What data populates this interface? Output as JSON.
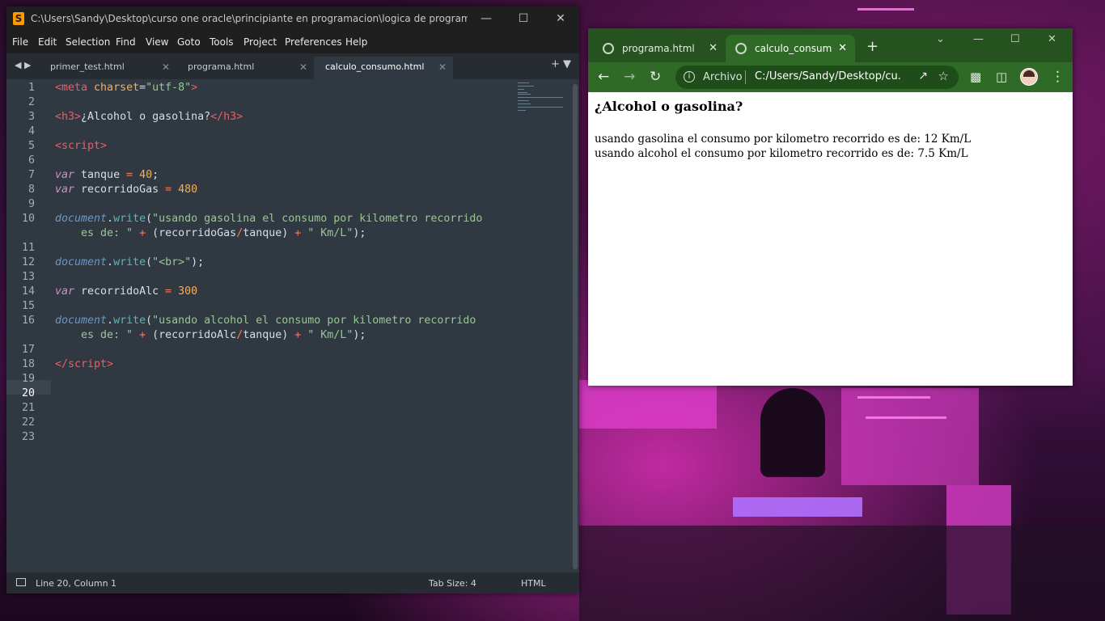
{
  "sublime": {
    "title": "C:\\Users\\Sandy\\Desktop\\curso one oracle\\principiante en programacion\\logica de programacion\\c...",
    "menu": [
      "File",
      "Edit",
      "Selection",
      "Find",
      "View",
      "Goto",
      "Tools",
      "Project",
      "Preferences",
      "Help"
    ],
    "tabs": [
      "primer_test.html",
      "programa.html",
      "calculo_consumo.html"
    ],
    "active_tab": "calculo_consumo.html",
    "line_numbers": [
      "1",
      "2",
      "3",
      "4",
      "5",
      "6",
      "7",
      "8",
      "9",
      "10",
      "",
      "11",
      "12",
      "13",
      "14",
      "15",
      "16",
      "",
      "17",
      "18",
      "19",
      "20",
      "21",
      "22",
      "23"
    ],
    "current_line": "20",
    "status": {
      "position": "Line 20, Column 1",
      "tab_size": "Tab Size: 4",
      "syntax": "HTML"
    }
  },
  "chrome": {
    "tabs": [
      "programa.html",
      "calculo_consumo.l"
    ],
    "address_prefix": "Archivo",
    "address_url": "C:/Users/Sandy/Desktop/cu...",
    "page": {
      "heading": "¿Alcohol o gasolina?",
      "lines": [
        "usando gasolina el consumo por kilometro recorrido es de: 12 Km/L",
        "usando alcohol el consumo por kilometro recorrido es de: 7.5 Km/L"
      ]
    }
  }
}
